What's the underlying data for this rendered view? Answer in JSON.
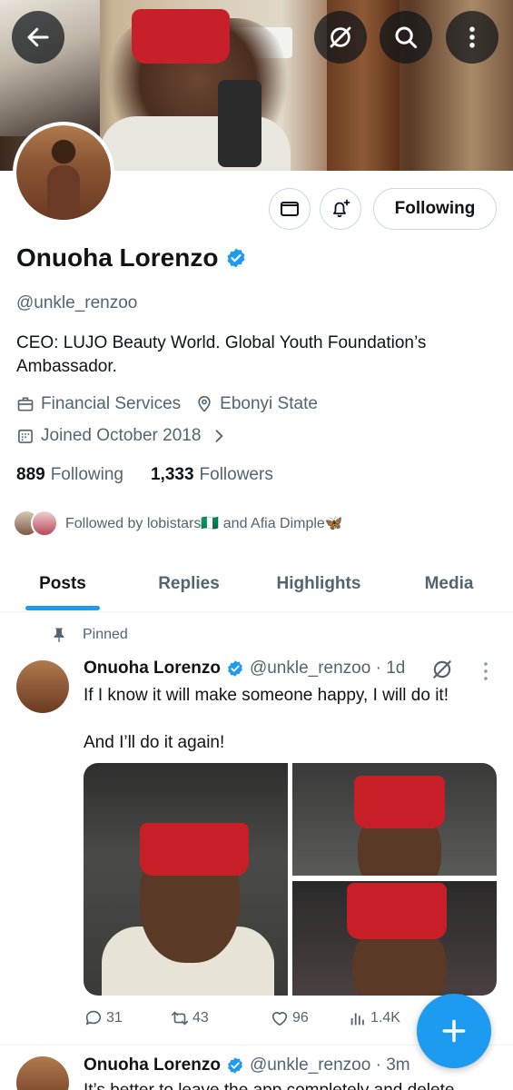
{
  "header": {
    "back_icon": "arrow-left-icon",
    "grok_icon": "grok-slash-icon",
    "search_icon": "search-icon",
    "more_icon": "more-vertical-icon"
  },
  "profile": {
    "name": "Onuoha Lorenzo",
    "handle": "@unkle_renzoo",
    "bio": "CEO: LUJO Beauty World. Global Youth Foundation’s Ambassador.",
    "category": "Financial Services",
    "location": "Ebonyi State",
    "joined": "Joined October 2018",
    "following_count": "889",
    "following_label": "Following",
    "followers_count": "1,333",
    "followers_label": "Followers",
    "followed_by": "Followed by lobistars🇳🇬 and Afia Dimple🦋"
  },
  "actions": {
    "message_icon": "envelope-icon",
    "notify_icon": "bell-plus-icon",
    "following_button": "Following"
  },
  "tabs": [
    {
      "label": "Posts",
      "active": true
    },
    {
      "label": "Replies",
      "active": false
    },
    {
      "label": "Highlights",
      "active": false
    },
    {
      "label": "Media",
      "active": false
    }
  ],
  "posts": [
    {
      "pinned_label": "Pinned",
      "author": "Onuoha Lorenzo",
      "handle_time": "@unkle_renzoo · 1d",
      "line1": "If I know it will make someone happy, I will do it!",
      "line2": "And I’ll do it again!",
      "replies": "31",
      "reposts": "43",
      "likes": "96",
      "views": "1.4K"
    },
    {
      "author": "Onuoha Lorenzo",
      "handle_time": "@unkle_renzoo · 3m",
      "text": "It’s better to leave the app completely and delete"
    }
  ],
  "colors": {
    "accent": "#1d9bf0",
    "text": "#0f1419",
    "secondary": "#536471"
  },
  "fab": {
    "icon": "plus-icon"
  }
}
